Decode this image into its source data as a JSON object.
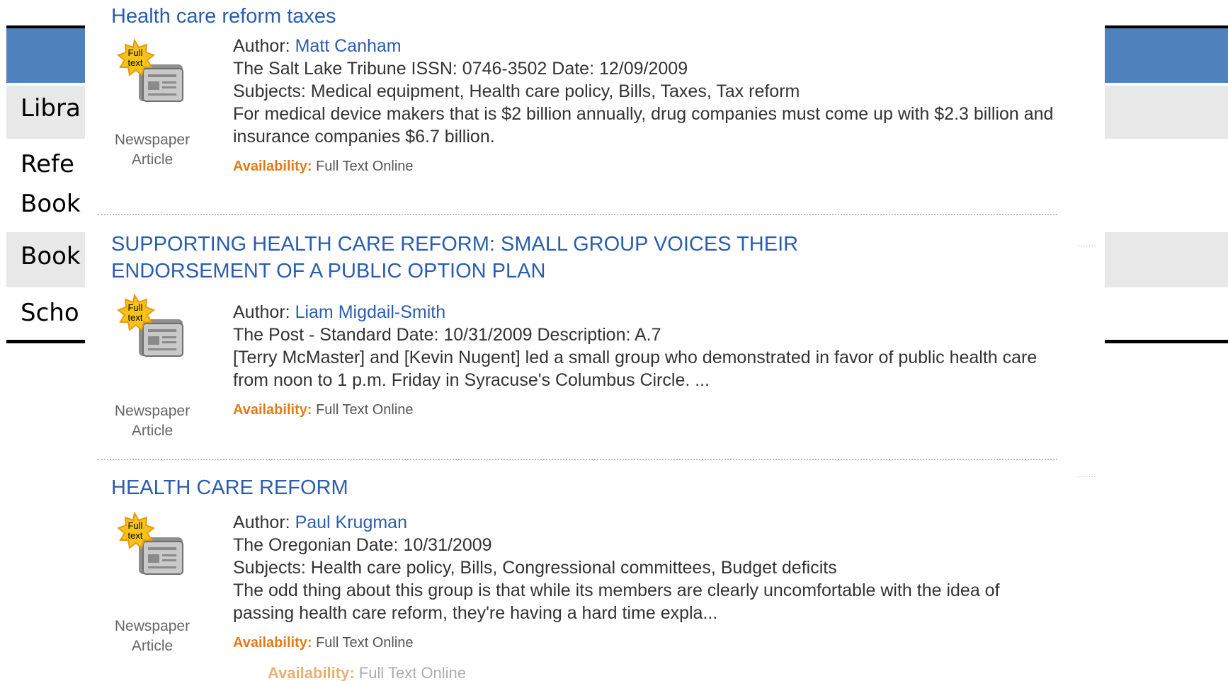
{
  "background_table": {
    "row1": "Libra",
    "row2_line1": "Refe",
    "row2_line2": "Book",
    "row3": "Book",
    "row4": "Scho"
  },
  "results": [
    {
      "title": "Health care reform taxes",
      "badge": "Full text",
      "type_line1": "Newspaper",
      "type_line2": "Article",
      "author_label": "Author:",
      "author": "Matt Canham",
      "source": "The Salt Lake Tribune ISSN: 0746-3502 Date: 12/09/2009",
      "subjects": "Subjects: Medical equipment, Health care policy, Bills, Taxes, Tax reform",
      "snippet": "For medical device makers that is $2 billion annually, drug companies must come up with $2.3 billion and insurance companies $6.7 billion.",
      "availability_label": "Availability:",
      "availability": "Full Text Online"
    },
    {
      "title": "SUPPORTING HEALTH CARE REFORM: SMALL GROUP VOICES THEIR ENDORSEMENT OF A PUBLIC OPTION PLAN",
      "title_line1": "SUPPORTING HEALTH CARE REFORM: SMALL GROUP VOICES THEIR",
      "title_line2": "ENDORSEMENT OF A PUBLIC OPTION PLAN",
      "badge": "Full text",
      "type_line1": "Newspaper",
      "type_line2": "Article",
      "author_label": "Author:",
      "author": "Liam Migdail-Smith",
      "source": "The Post - Standard Date: 10/31/2009 Description: A.7",
      "snippet": "[Terry McMaster] and [Kevin Nugent] led a small group who demonstrated in favor of public health care from noon to 1 p.m. Friday in Syracuse's Columbus Circle. ...",
      "availability_label": "Availability:",
      "availability": "Full Text Online"
    },
    {
      "title": "HEALTH CARE REFORM",
      "badge": "Full text",
      "type_line1": "Newspaper",
      "type_line2": "Article",
      "author_label": "Author:",
      "author": "Paul Krugman",
      "source": "The Oregonian Date: 10/31/2009",
      "subjects": "Subjects: Health care policy, Bills, Congressional committees, Budget deficits",
      "snippet": "The odd thing about this group is that while its members are clearly uncomfortable with the idea of passing health care reform, they're having a hard time expla...",
      "availability_label": "Availability:",
      "availability": "Full Text Online"
    }
  ],
  "ghost_line": {
    "label": "Availability:",
    "value": "Full Text Online"
  },
  "colors": {
    "link": "#2a5db0",
    "availability": "#e07b17",
    "header_blue": "#4f81bd",
    "badge": "#f7c21b"
  }
}
